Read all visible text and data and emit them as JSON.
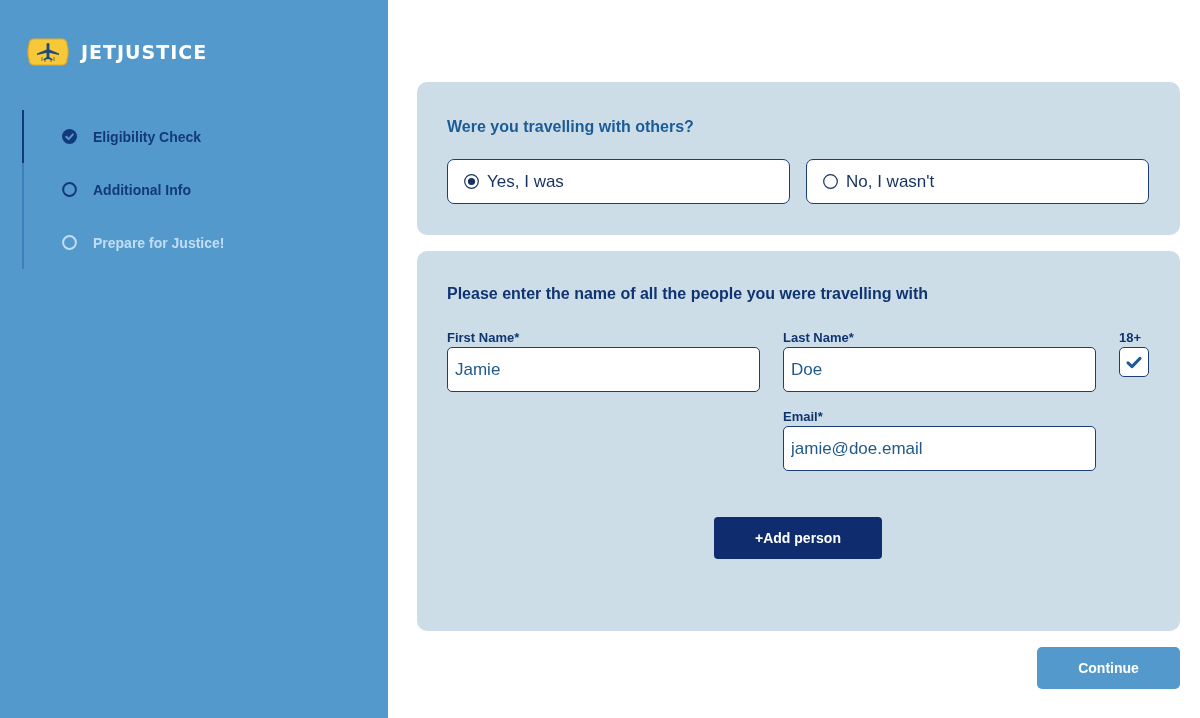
{
  "brand": {
    "name": "JETJUSTICE"
  },
  "steps": [
    {
      "label": "Eligibility Check",
      "selected": true,
      "completed": true,
      "disabled": false
    },
    {
      "label": "Additional Info",
      "selected": false,
      "completed": false,
      "disabled": false
    },
    {
      "label": "Prepare for Justice!",
      "selected": false,
      "completed": false,
      "disabled": true
    }
  ],
  "travel_question": {
    "title": "Were you travelling with others?",
    "options": [
      {
        "label": "Yes, I was",
        "selected": true
      },
      {
        "label": "No, I wasn't",
        "selected": false
      }
    ]
  },
  "companions": {
    "title": "Please enter the name of all the people you were travelling with",
    "people": [
      {
        "first_name": {
          "label": "First Name*",
          "value": "Jamie"
        },
        "last_name": {
          "label": "Last Name*",
          "value": "Doe"
        },
        "adult": {
          "label": "18+",
          "checked": true
        },
        "email": {
          "label": "Email*",
          "value": "jamie@doe.email"
        }
      }
    ],
    "add_button": "+Add person"
  },
  "continue_button": "Continue"
}
